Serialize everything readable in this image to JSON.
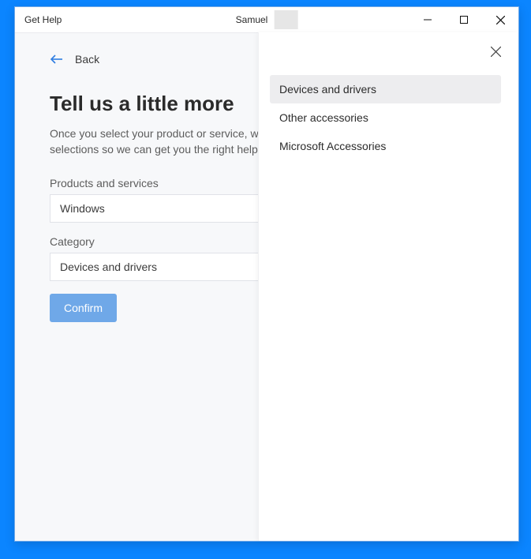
{
  "titlebar": {
    "app_name": "Get Help",
    "user_name": "Samuel"
  },
  "back_label": "Back",
  "heading": "Tell us a little more",
  "description": "Once you select your product or service, we may use that info to narrow down selections so we can get you the right help.",
  "fields": {
    "products_label": "Products and services",
    "products_value": "Windows",
    "category_label": "Category",
    "category_value": "Devices and drivers"
  },
  "confirm_label": "Confirm",
  "panel": {
    "items": [
      {
        "label": "Devices and drivers",
        "selected": true
      },
      {
        "label": "Other accessories",
        "selected": false
      },
      {
        "label": "Microsoft Accessories",
        "selected": false
      }
    ]
  }
}
